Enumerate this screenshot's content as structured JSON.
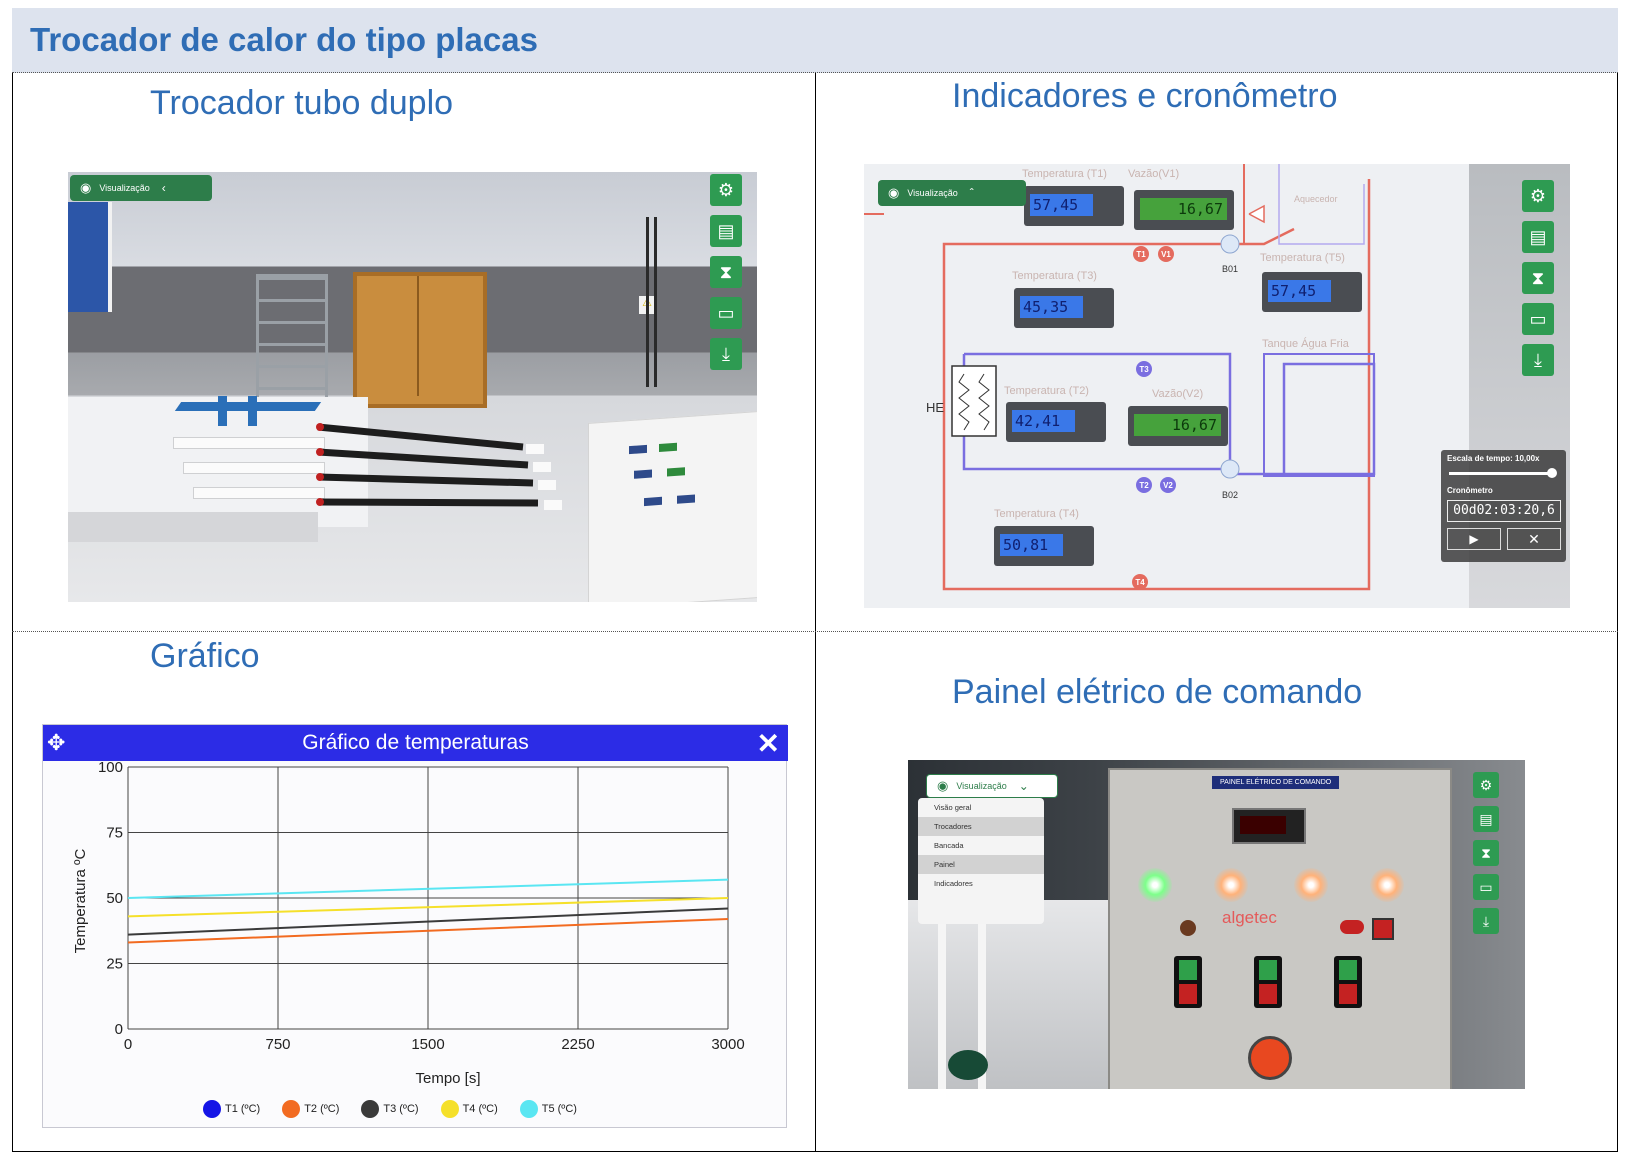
{
  "header": {
    "title": "Trocador de calor do tipo placas"
  },
  "sections": {
    "tubo": "Trocador tubo duplo",
    "indicadores": "Indicadores e cronômetro",
    "grafico": "Gráfico",
    "painel": "Painel elétrico de comando"
  },
  "viewer": {
    "visualizacao": "Visualização"
  },
  "indicators": {
    "t1": {
      "label": "Temperatura (T1)",
      "value": "57,45"
    },
    "v1": {
      "label": "Vazão(V1)",
      "value": "16,67"
    },
    "t3": {
      "label": "Temperatura (T3)",
      "value": "45,35"
    },
    "t5": {
      "label": "Temperatura (T5)",
      "value": "57,45"
    },
    "t2": {
      "label": "Temperatura (T2)",
      "value": "42,41"
    },
    "v2": {
      "label": "Vazão(V2)",
      "value": "16,67"
    },
    "t4": {
      "label": "Temperatura (T4)",
      "value": "50,81"
    },
    "tank": "Tanque Água Fria",
    "aquecedor": "Aquecedor",
    "he": "HE",
    "b01": "B01",
    "b02": "B02",
    "sensors": {
      "T1": "T1",
      "V1": "V1",
      "T3": "T3",
      "T2": "T2",
      "V2": "V2",
      "T4": "T4"
    }
  },
  "timer": {
    "scale_label": "Escala de tempo: 10,00x",
    "scale_fraction": 0.97,
    "chrono_label": "Cronômetro",
    "chrono_value": "00d02:03:20,6"
  },
  "chart_data": {
    "type": "line",
    "title": "Gráfico de temperaturas",
    "xlabel": "Tempo [s]",
    "ylabel": "Temperatura ºC",
    "xlim": [
      0,
      3000
    ],
    "ylim": [
      0,
      100
    ],
    "xticks": [
      0,
      750,
      1500,
      2250,
      3000
    ],
    "yticks": [
      0,
      25,
      50,
      75,
      100
    ],
    "grid": true,
    "legend_position": "bottom",
    "series": [
      {
        "name": "T1 (ºC)",
        "color": "#1414e6",
        "x": [
          0,
          3000
        ],
        "y": [
          null,
          null
        ]
      },
      {
        "name": "T2 (ºC)",
        "color": "#f26b21",
        "x": [
          0,
          3000
        ],
        "y": [
          33,
          42
        ]
      },
      {
        "name": "T3 (ºC)",
        "color": "#3a3a3a",
        "x": [
          0,
          3000
        ],
        "y": [
          36,
          46
        ]
      },
      {
        "name": "T4 (ºC)",
        "color": "#f5e02a",
        "x": [
          0,
          3000
        ],
        "y": [
          43,
          50
        ]
      },
      {
        "name": "T5 (ºC)",
        "color": "#5ae6f2",
        "x": [
          0,
          3000
        ],
        "y": [
          50,
          57
        ]
      }
    ]
  },
  "panel": {
    "title": "PAINEL ELÉTRICO DE COMANDO",
    "brand": "algetec",
    "menu_items": [
      "Visão geral",
      "Trocadores",
      "Bancada",
      "Painel",
      "Indicadores"
    ]
  },
  "colors": {
    "title_blue": "#2f6db5",
    "toolbar_green": "#2e9b52",
    "hot_line": "#e46b5e",
    "cold_line": "#7a6ee0"
  }
}
